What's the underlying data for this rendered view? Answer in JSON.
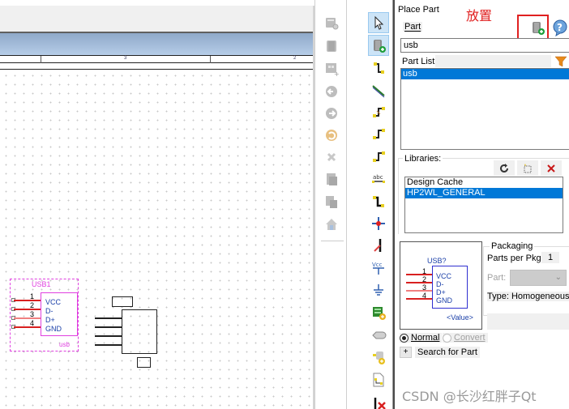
{
  "canvas": {
    "ruler_numbers": [
      "3",
      "2"
    ],
    "placed_part": {
      "reference": "USB1",
      "value": "usb",
      "pins": [
        {
          "number": "1",
          "name": "VCC"
        },
        {
          "number": "2",
          "name": "D-"
        },
        {
          "number": "3",
          "name": "D+"
        },
        {
          "number": "4",
          "name": "GND"
        }
      ]
    }
  },
  "toolbar_left": {
    "icons": [
      "part-properties-icon",
      "part-icon",
      "add-hierarchy-icon",
      "back-icon",
      "forward-icon",
      "undo-icon",
      "delete-icon",
      "copy-page-icon",
      "paste-page-icon",
      "home-icon"
    ]
  },
  "toolbar_right": {
    "icons": [
      "select-icon",
      "place-part-icon",
      "place-wire-icon",
      "place-net-group-icon",
      "place-bus-icon",
      "place-bus-entry-icon",
      "place-bus-entry-2-icon",
      "place-net-alias-icon",
      "place-net-flag-icon",
      "place-junction-icon",
      "place-no-connect-icon",
      "place-power-icon",
      "place-ground-icon",
      "place-hierarchical-block-icon",
      "place-port-icon",
      "place-pin-icon",
      "place-off-page-icon",
      "place-no-erc-icon"
    ]
  },
  "panel": {
    "title": "Place Part",
    "annotation": "放置",
    "part_label": "Part",
    "part_value": "usb",
    "part_list_label": "Part List:",
    "part_list": [
      {
        "label": "usb",
        "selected": true
      }
    ],
    "libraries_label": "Libraries:",
    "libraries": [
      {
        "label": "Design Cache",
        "selected": false
      },
      {
        "label": "HP2WL_GENERAL",
        "selected": true
      }
    ],
    "preview": {
      "reference": "USB?",
      "value": "<Value>",
      "pins": [
        {
          "number": "1",
          "name": "VCC"
        },
        {
          "number": "2",
          "name": "D-"
        },
        {
          "number": "3",
          "name": "D+"
        },
        {
          "number": "4",
          "name": "GND"
        }
      ]
    },
    "packaging": {
      "label": "Packaging",
      "parts_per_pkg_label": "Parts per Pkg:",
      "parts_per_pkg_value": "1",
      "part_label": "Part:",
      "part_value": "",
      "type_label": "Type: Homogeneous"
    },
    "radio_normal": "Normal",
    "radio_convert": "Convert",
    "search_label": "Search for Part",
    "search_expand": "+"
  },
  "watermark": "CSDN @长沙红胖子Qt",
  "colors": {
    "selection": "#0078d7",
    "part_magenta": "#e040e0",
    "pin_red": "#d82020",
    "pin_name_blue": "#1a3fa8",
    "annotation_red": "#e02020"
  }
}
